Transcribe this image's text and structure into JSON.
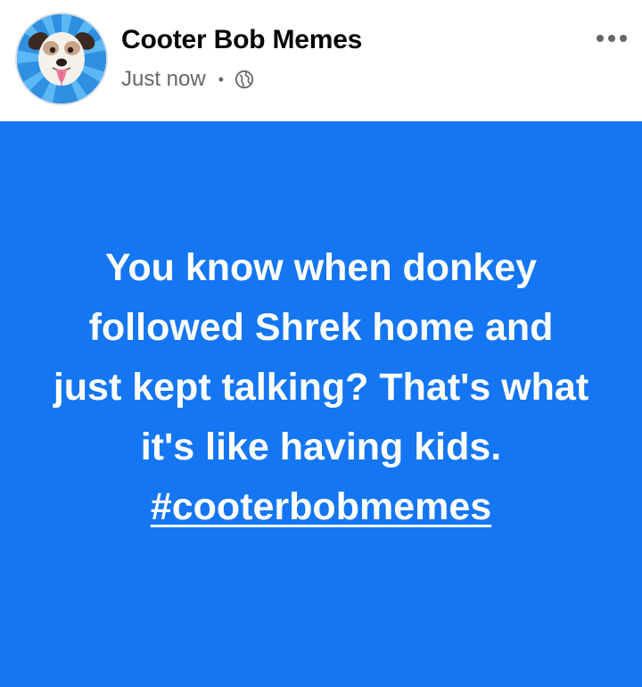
{
  "post": {
    "author": "Cooter Bob Memes",
    "timestamp": "Just now",
    "separator": "•",
    "privacy_icon": "globe-icon",
    "more_icon": "more-horizontal-icon",
    "body_lines": [
      "You know when donkey",
      "followed Shrek home and",
      "just kept talking? That's what",
      "it's like having kids."
    ],
    "hashtag": "#cooterbobmemes",
    "background_color": "#1476f2",
    "text_color": "#ffffff"
  }
}
